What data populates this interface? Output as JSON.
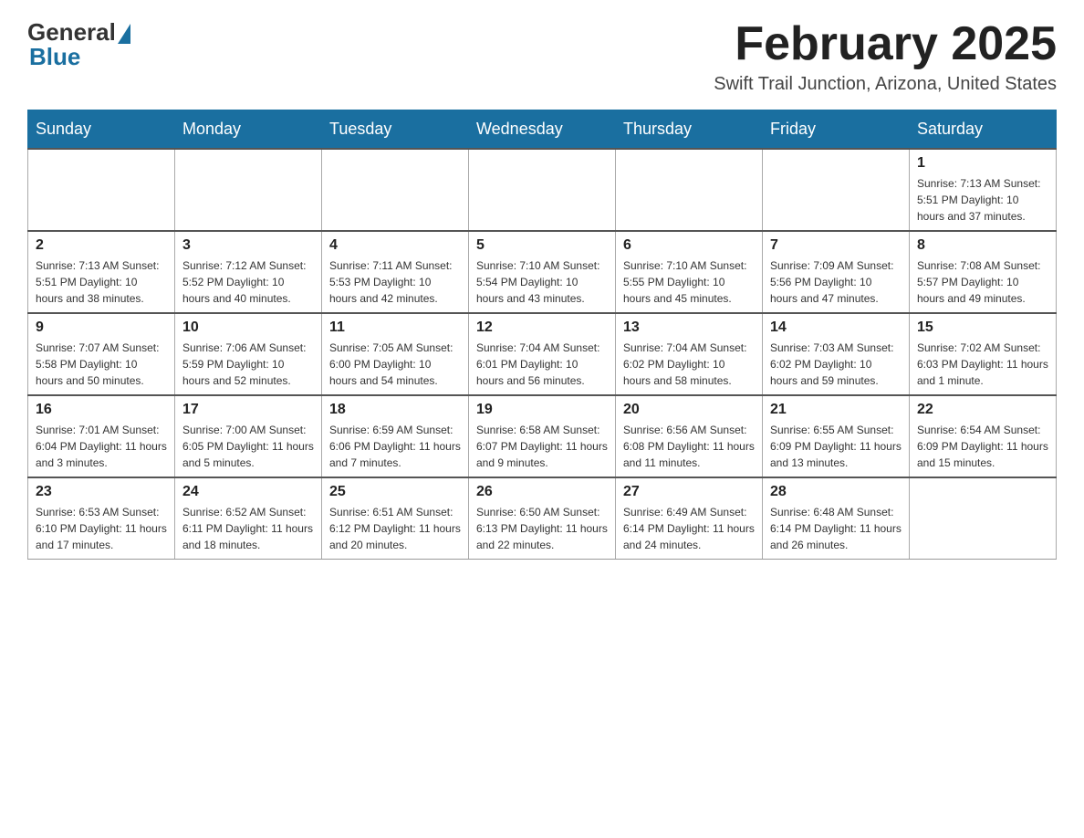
{
  "header": {
    "logo_general": "General",
    "logo_blue": "Blue",
    "month_title": "February 2025",
    "location": "Swift Trail Junction, Arizona, United States"
  },
  "weekdays": [
    "Sunday",
    "Monday",
    "Tuesday",
    "Wednesday",
    "Thursday",
    "Friday",
    "Saturday"
  ],
  "weeks": [
    {
      "days": [
        {
          "num": "",
          "info": ""
        },
        {
          "num": "",
          "info": ""
        },
        {
          "num": "",
          "info": ""
        },
        {
          "num": "",
          "info": ""
        },
        {
          "num": "",
          "info": ""
        },
        {
          "num": "",
          "info": ""
        },
        {
          "num": "1",
          "info": "Sunrise: 7:13 AM\nSunset: 5:51 PM\nDaylight: 10 hours\nand 37 minutes."
        }
      ]
    },
    {
      "days": [
        {
          "num": "2",
          "info": "Sunrise: 7:13 AM\nSunset: 5:51 PM\nDaylight: 10 hours\nand 38 minutes."
        },
        {
          "num": "3",
          "info": "Sunrise: 7:12 AM\nSunset: 5:52 PM\nDaylight: 10 hours\nand 40 minutes."
        },
        {
          "num": "4",
          "info": "Sunrise: 7:11 AM\nSunset: 5:53 PM\nDaylight: 10 hours\nand 42 minutes."
        },
        {
          "num": "5",
          "info": "Sunrise: 7:10 AM\nSunset: 5:54 PM\nDaylight: 10 hours\nand 43 minutes."
        },
        {
          "num": "6",
          "info": "Sunrise: 7:10 AM\nSunset: 5:55 PM\nDaylight: 10 hours\nand 45 minutes."
        },
        {
          "num": "7",
          "info": "Sunrise: 7:09 AM\nSunset: 5:56 PM\nDaylight: 10 hours\nand 47 minutes."
        },
        {
          "num": "8",
          "info": "Sunrise: 7:08 AM\nSunset: 5:57 PM\nDaylight: 10 hours\nand 49 minutes."
        }
      ]
    },
    {
      "days": [
        {
          "num": "9",
          "info": "Sunrise: 7:07 AM\nSunset: 5:58 PM\nDaylight: 10 hours\nand 50 minutes."
        },
        {
          "num": "10",
          "info": "Sunrise: 7:06 AM\nSunset: 5:59 PM\nDaylight: 10 hours\nand 52 minutes."
        },
        {
          "num": "11",
          "info": "Sunrise: 7:05 AM\nSunset: 6:00 PM\nDaylight: 10 hours\nand 54 minutes."
        },
        {
          "num": "12",
          "info": "Sunrise: 7:04 AM\nSunset: 6:01 PM\nDaylight: 10 hours\nand 56 minutes."
        },
        {
          "num": "13",
          "info": "Sunrise: 7:04 AM\nSunset: 6:02 PM\nDaylight: 10 hours\nand 58 minutes."
        },
        {
          "num": "14",
          "info": "Sunrise: 7:03 AM\nSunset: 6:02 PM\nDaylight: 10 hours\nand 59 minutes."
        },
        {
          "num": "15",
          "info": "Sunrise: 7:02 AM\nSunset: 6:03 PM\nDaylight: 11 hours\nand 1 minute."
        }
      ]
    },
    {
      "days": [
        {
          "num": "16",
          "info": "Sunrise: 7:01 AM\nSunset: 6:04 PM\nDaylight: 11 hours\nand 3 minutes."
        },
        {
          "num": "17",
          "info": "Sunrise: 7:00 AM\nSunset: 6:05 PM\nDaylight: 11 hours\nand 5 minutes."
        },
        {
          "num": "18",
          "info": "Sunrise: 6:59 AM\nSunset: 6:06 PM\nDaylight: 11 hours\nand 7 minutes."
        },
        {
          "num": "19",
          "info": "Sunrise: 6:58 AM\nSunset: 6:07 PM\nDaylight: 11 hours\nand 9 minutes."
        },
        {
          "num": "20",
          "info": "Sunrise: 6:56 AM\nSunset: 6:08 PM\nDaylight: 11 hours\nand 11 minutes."
        },
        {
          "num": "21",
          "info": "Sunrise: 6:55 AM\nSunset: 6:09 PM\nDaylight: 11 hours\nand 13 minutes."
        },
        {
          "num": "22",
          "info": "Sunrise: 6:54 AM\nSunset: 6:09 PM\nDaylight: 11 hours\nand 15 minutes."
        }
      ]
    },
    {
      "days": [
        {
          "num": "23",
          "info": "Sunrise: 6:53 AM\nSunset: 6:10 PM\nDaylight: 11 hours\nand 17 minutes."
        },
        {
          "num": "24",
          "info": "Sunrise: 6:52 AM\nSunset: 6:11 PM\nDaylight: 11 hours\nand 18 minutes."
        },
        {
          "num": "25",
          "info": "Sunrise: 6:51 AM\nSunset: 6:12 PM\nDaylight: 11 hours\nand 20 minutes."
        },
        {
          "num": "26",
          "info": "Sunrise: 6:50 AM\nSunset: 6:13 PM\nDaylight: 11 hours\nand 22 minutes."
        },
        {
          "num": "27",
          "info": "Sunrise: 6:49 AM\nSunset: 6:14 PM\nDaylight: 11 hours\nand 24 minutes."
        },
        {
          "num": "28",
          "info": "Sunrise: 6:48 AM\nSunset: 6:14 PM\nDaylight: 11 hours\nand 26 minutes."
        },
        {
          "num": "",
          "info": ""
        }
      ]
    }
  ]
}
